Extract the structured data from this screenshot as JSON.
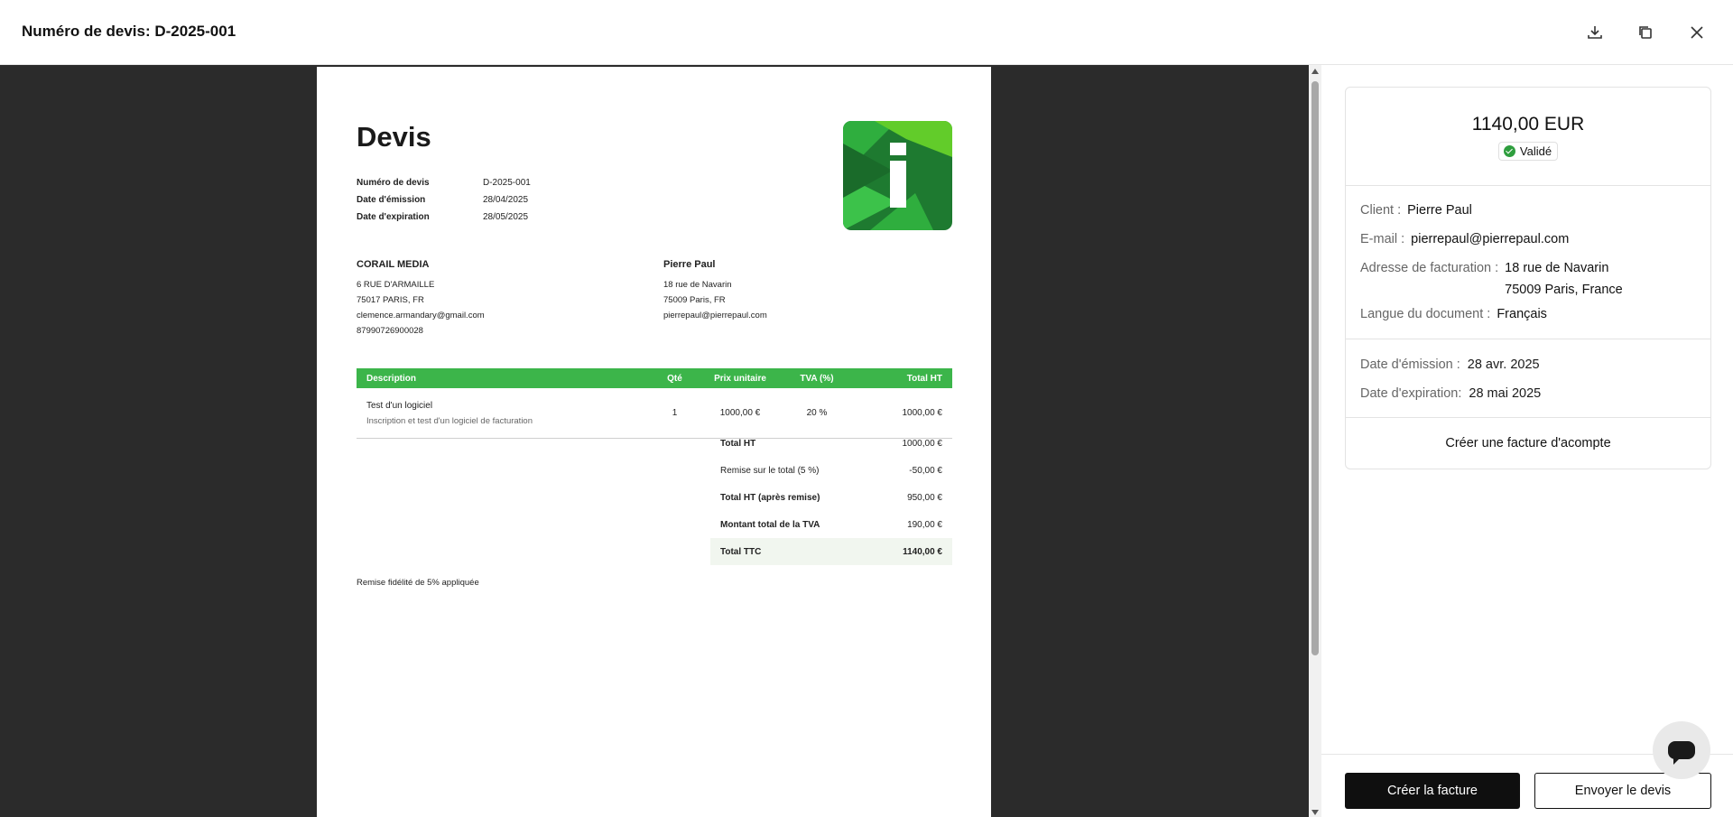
{
  "header": {
    "title": "Numéro de devis: D-2025-001",
    "actions": [
      "download-icon",
      "copy-icon",
      "close-icon"
    ]
  },
  "document": {
    "heading": "Devis",
    "meta": [
      {
        "label": "Numéro de devis",
        "value": "D-2025-001"
      },
      {
        "label": "Date d'émission",
        "value": "28/04/2025"
      },
      {
        "label": "Date d'expiration",
        "value": "28/05/2025"
      }
    ],
    "from": {
      "name": "CORAIL MEDIA",
      "lines": [
        "6 RUE D'ARMAILLE",
        "75017 PARIS, FR",
        "clemence.armandary@gmail.com",
        "87990726900028"
      ]
    },
    "to": {
      "name": "Pierre Paul",
      "lines": [
        "18 rue de Navarin",
        "75009 Paris, FR",
        "pierrepaul@pierrepaul.com"
      ]
    },
    "table": {
      "headers": [
        "Description",
        "Qté",
        "Prix unitaire",
        "TVA (%)",
        "Total HT"
      ],
      "rows": [
        {
          "title": "Test d'un logiciel",
          "subtitle": "Inscription et test d'un logiciel de facturation",
          "qty": "1",
          "unit_price": "1000,00 €",
          "vat": "20 %",
          "total": "1000,00 €"
        }
      ]
    },
    "totals": [
      {
        "label": "Total HT",
        "value": "1000,00 €"
      },
      {
        "label": "Remise sur le total (5 %)",
        "value": "-50,00 €"
      },
      {
        "label": "Total HT (après remise)",
        "value": "950,00 €"
      },
      {
        "label": "Montant total de la TVA",
        "value": "190,00 €"
      },
      {
        "label": "Total TTC",
        "value": "1140,00 €"
      }
    ],
    "note": "Remise fidélité de 5% appliquée"
  },
  "summary": {
    "amount": "1140,00 EUR",
    "status": "Validé",
    "status_color": "#2e9e3e",
    "client_label": "Client :",
    "client": "Pierre Paul",
    "email_label": "E-mail :",
    "email": "pierrepaul@pierrepaul.com",
    "address_label": "Adresse de facturation :",
    "address_line1": "18 rue de Navarin",
    "address_line2": "75009 Paris, France",
    "language_label": "Langue du document :",
    "language": "Français",
    "issue_label": "Date d'émission :",
    "issue": "28 avr. 2025",
    "expiry_label": "Date d'expiration:",
    "expiry": "28 mai 2025",
    "acompte": "Créer une facture d'acompte"
  },
  "buttons": {
    "create_invoice": "Créer la facture",
    "send_quote": "Envoyer le devis"
  },
  "colors": {
    "accent_green": "#3cb54a",
    "viewer_bg": "#2b2b2b"
  }
}
